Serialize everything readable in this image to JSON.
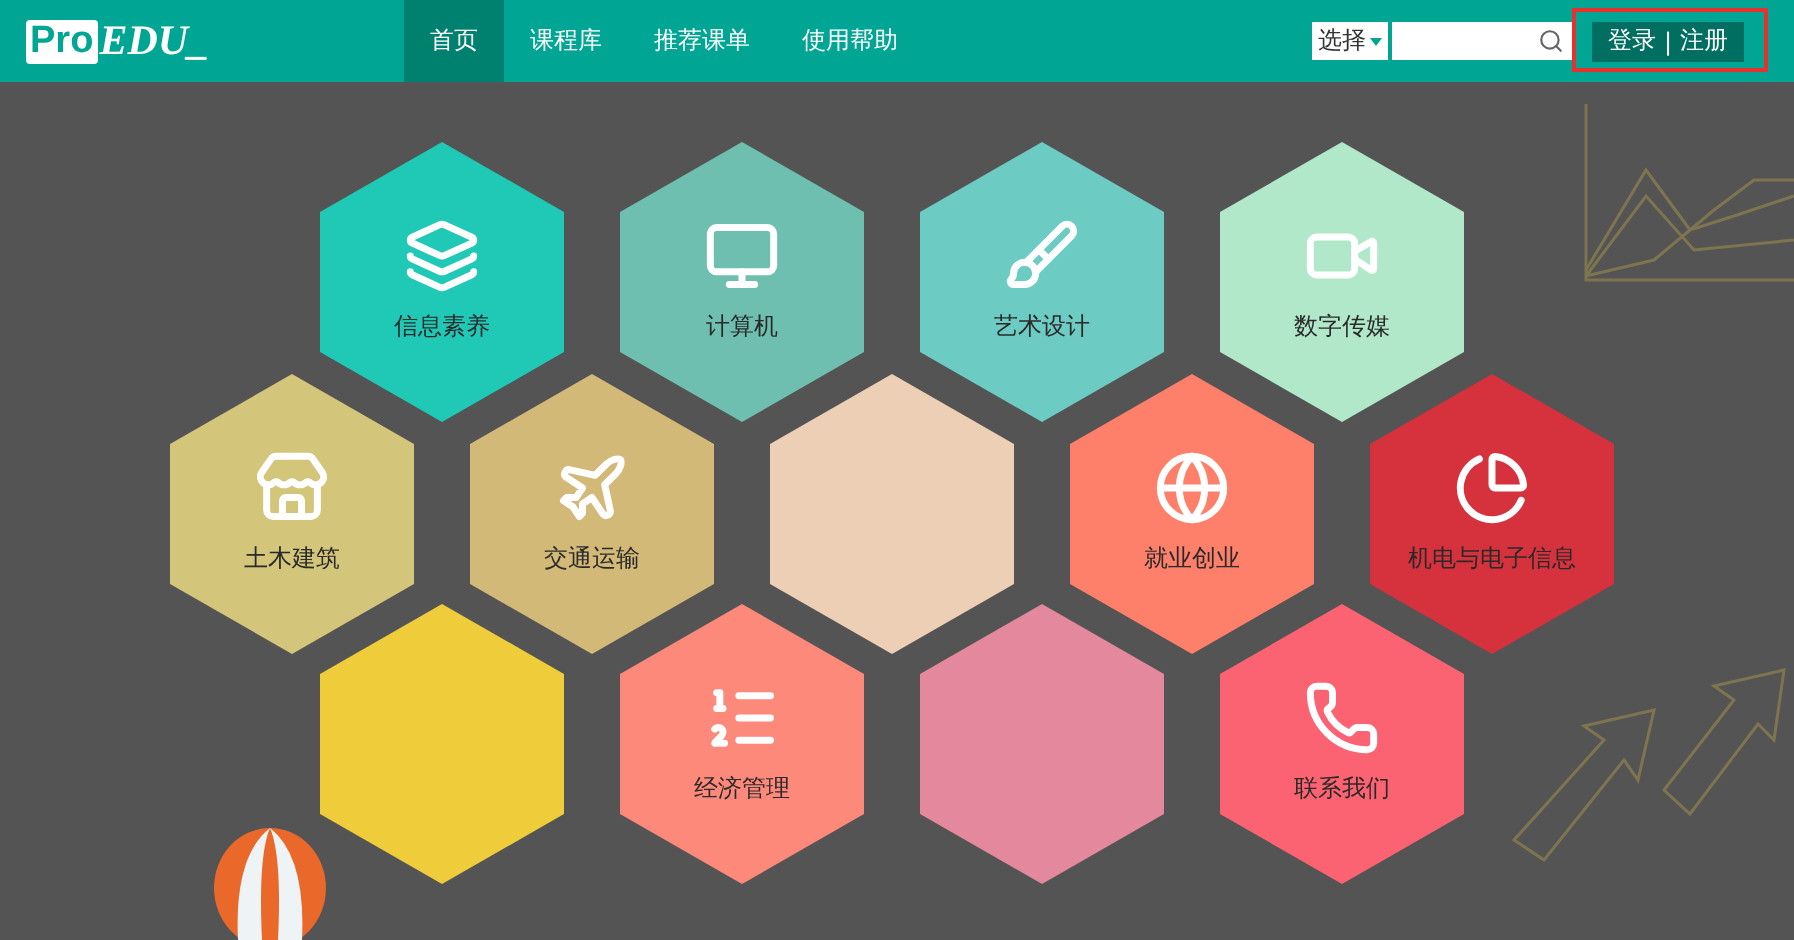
{
  "header": {
    "logo": {
      "boxed": "Pro",
      "rest": "EDU_"
    },
    "nav": [
      {
        "label": "首页",
        "selected": true
      },
      {
        "label": "课程库",
        "selected": false
      },
      {
        "label": "推荐课单",
        "selected": false
      },
      {
        "label": "使用帮助",
        "selected": false
      }
    ],
    "search": {
      "select": "选择"
    },
    "auth": {
      "login": "登录",
      "separator": "|",
      "register": "注册"
    },
    "highlighted": true
  },
  "tiles": [
    [
      {
        "kind": "labeled",
        "label": "信息素养",
        "color": "#20c8b6"
      },
      {
        "kind": "labeled",
        "label": "计算机",
        "color": "#6fbfb1"
      },
      {
        "kind": "labeled",
        "label": "艺术设计",
        "color": "#6ccbc3"
      },
      {
        "kind": "labeled",
        "label": "数字传媒",
        "color": "#b0e8c9"
      }
    ],
    [
      {
        "kind": "labeled",
        "label": "土木建筑",
        "color": "#d3c57a"
      },
      {
        "kind": "labeled",
        "label": "交通运输",
        "color": "#d3b978"
      },
      {
        "kind": "blank",
        "color": "#eccfb4"
      },
      {
        "kind": "labeled",
        "label": "就业创业",
        "color": "#fe7f6a"
      },
      {
        "kind": "labeled",
        "label": "机电与电子信息",
        "color": "#d6323e"
      }
    ],
    [
      {
        "kind": "blank",
        "color": "#eecc3a"
      },
      {
        "kind": "labeled",
        "label": "经济管理",
        "color": "#fd897b"
      },
      {
        "kind": "blank",
        "color": "#e4889d"
      },
      {
        "kind": "labeled",
        "label": "联系我们",
        "color": "#fc6372"
      }
    ]
  ]
}
